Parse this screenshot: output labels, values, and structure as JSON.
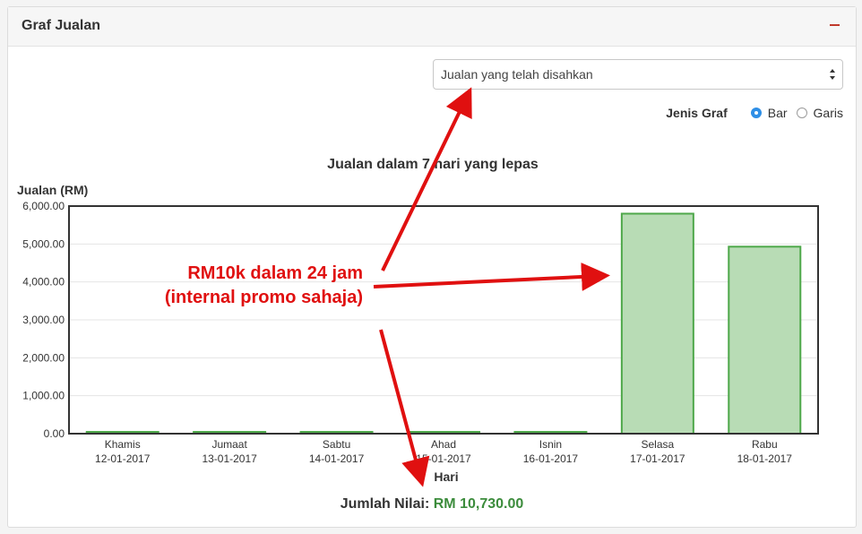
{
  "panel": {
    "title": "Graf Jualan"
  },
  "filter": {
    "selected": "Jualan yang telah disahkan"
  },
  "graph_type": {
    "label": "Jenis Graf",
    "options": [
      {
        "label": "Bar",
        "checked": true
      },
      {
        "label": "Garis",
        "checked": false
      }
    ]
  },
  "chart_data": {
    "type": "bar",
    "title": "Jualan dalam 7 hari yang lepas",
    "ylabel": "Jualan (RM)",
    "xlabel": "Hari",
    "ylim": [
      0,
      6000
    ],
    "yticks": [
      "0.00",
      "1,000.00",
      "2,000.00",
      "3,000.00",
      "4,000.00",
      "5,000.00",
      "6,000.00"
    ],
    "categories": [
      [
        "Khamis",
        "12-01-2017"
      ],
      [
        "Jumaat",
        "13-01-2017"
      ],
      [
        "Sabtu",
        "14-01-2017"
      ],
      [
        "Ahad",
        "15-01-2017"
      ],
      [
        "Isnin",
        "16-01-2017"
      ],
      [
        "Selasa",
        "17-01-2017"
      ],
      [
        "Rabu",
        "18-01-2017"
      ]
    ],
    "values": [
      0,
      0,
      0,
      0,
      0,
      5800,
      4930
    ],
    "grid": true,
    "colors": {
      "bar_fill": "#b8dcb5",
      "bar_stroke": "#4ea84a"
    }
  },
  "annotation": {
    "lines": [
      "RM10k dalam 24 jam",
      "(internal promo sahaja)"
    ],
    "color": "#e01010"
  },
  "total": {
    "label": "Jumlah Nilai:",
    "value": "RM 10,730.00"
  }
}
